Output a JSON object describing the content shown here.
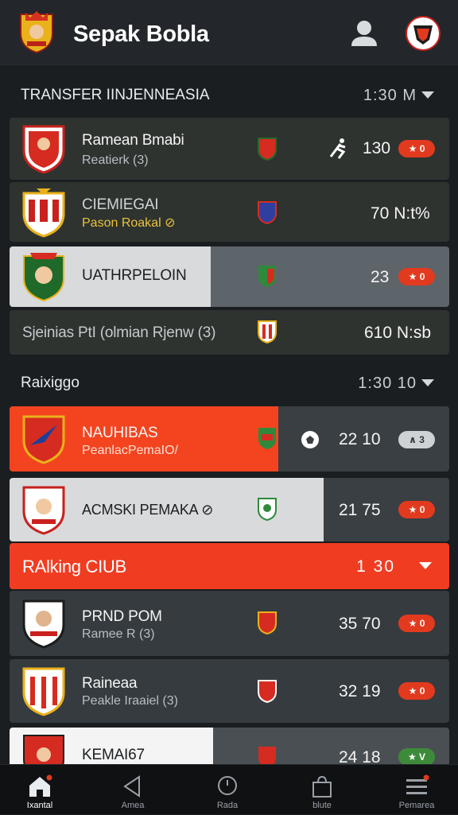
{
  "app": {
    "title": "Sepak Bobla"
  },
  "sections": {
    "transfer": {
      "label": "TRANSFER  IINJENNEASIA",
      "time": "1:30  M"
    },
    "ranking": {
      "label": "Raixiggo",
      "time": "1:30  10"
    },
    "club": {
      "label": "RAlking CIUB",
      "time": "1  30"
    }
  },
  "rows": [
    {
      "name": "Ramean Bmabi",
      "sub": "Reatierk (3)",
      "stat": "130",
      "pill": "★ 0"
    },
    {
      "name": "CIEMIEGAI",
      "sub": "Pason Roakal ⊘",
      "stat": "70  N:t%"
    },
    {
      "name": "UATHRPELOIN",
      "stat": "23",
      "pill": "★ 0"
    },
    {
      "name": "Sjeinias PtI (olmian Rjenw (3)",
      "stat": "610  N:sb"
    },
    {
      "name": "NAUHIBAS",
      "sub": "PeanlacPemaIO/",
      "stat": "22   10",
      "pill": "∧ 3"
    },
    {
      "name": "ACMSKI PEMAKA ⊘",
      "stat": "21   75",
      "pill": "★ 0"
    },
    {
      "name": "PRND POM",
      "sub": "Ramee R (3)",
      "stat": "35   70",
      "pill": "★ 0"
    },
    {
      "name": "Raineaa",
      "sub": "Peakle Iraaiel (3)",
      "stat": "32   19",
      "pill": "★ 0"
    },
    {
      "name": "KEMAI67",
      "stat": "24   18",
      "pill": "★ V"
    }
  ],
  "tabs": [
    {
      "label": "Ixantal",
      "icon": "home-icon"
    },
    {
      "label": "Amea",
      "icon": "back-arrow-icon"
    },
    {
      "label": "Rada",
      "icon": "search-icon"
    },
    {
      "label": "blute",
      "icon": "bag-icon"
    },
    {
      "label": "Pemarea",
      "icon": "menu-icon"
    }
  ],
  "colors": {
    "accent": "#f03d22",
    "background": "#1b1e21",
    "row": "#363b3f"
  }
}
